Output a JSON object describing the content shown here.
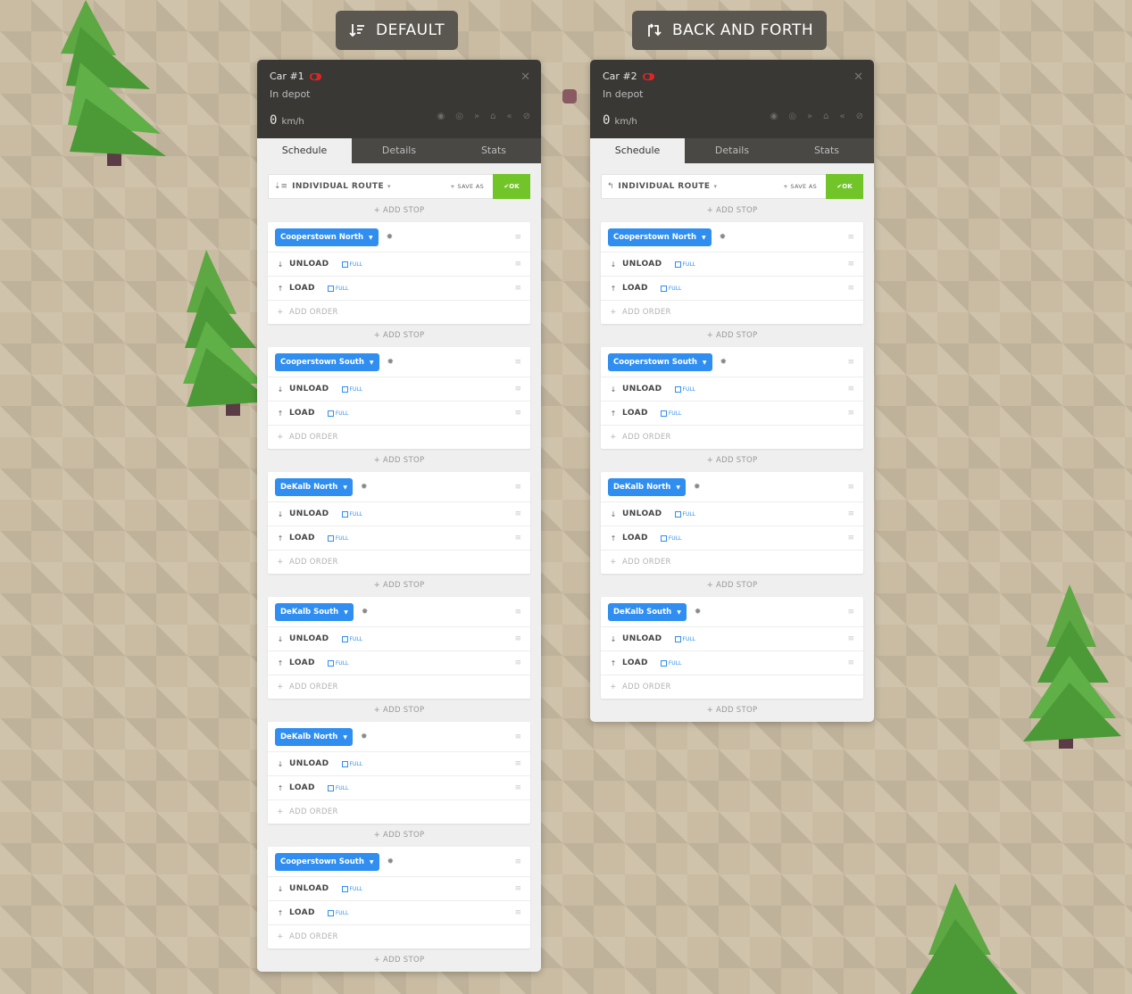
{
  "modes": [
    {
      "label": "DEFAULT",
      "icon": "sort-descending-icon"
    },
    {
      "label": "BACK AND FORTH",
      "icon": "return-arrow-icon"
    }
  ],
  "panels": [
    {
      "car_title": "Car #1",
      "status": "In depot",
      "speed": "0",
      "speed_unit": "km/h",
      "tabs": [
        "Schedule",
        "Details",
        "Stats"
      ],
      "route_type": "INDIVIDUAL ROUTE",
      "save_as": "SAVE AS",
      "ok": "OK",
      "add_stop": "ADD STOP",
      "add_order": "ADD ORDER",
      "stops": [
        {
          "station": "Cooperstown North",
          "orders": [
            {
              "name": "UNLOAD",
              "full": "FULL"
            },
            {
              "name": "LOAD",
              "full": "FULL"
            }
          ]
        },
        {
          "station": "Cooperstown South",
          "orders": [
            {
              "name": "UNLOAD",
              "full": "FULL"
            },
            {
              "name": "LOAD",
              "full": "FULL"
            }
          ]
        },
        {
          "station": "DeKalb North",
          "orders": [
            {
              "name": "UNLOAD",
              "full": "FULL"
            },
            {
              "name": "LOAD",
              "full": "FULL"
            }
          ]
        },
        {
          "station": "DeKalb South",
          "orders": [
            {
              "name": "UNLOAD",
              "full": "FULL"
            },
            {
              "name": "LOAD",
              "full": "FULL"
            }
          ]
        },
        {
          "station": "DeKalb North",
          "orders": [
            {
              "name": "UNLOAD",
              "full": "FULL"
            },
            {
              "name": "LOAD",
              "full": "FULL"
            }
          ]
        },
        {
          "station": "Cooperstown South",
          "orders": [
            {
              "name": "UNLOAD",
              "full": "FULL"
            },
            {
              "name": "LOAD",
              "full": "FULL"
            }
          ]
        }
      ]
    },
    {
      "car_title": "Car #2",
      "status": "In depot",
      "speed": "0",
      "speed_unit": "km/h",
      "tabs": [
        "Schedule",
        "Details",
        "Stats"
      ],
      "route_type": "INDIVIDUAL ROUTE",
      "save_as": "SAVE AS",
      "ok": "OK",
      "add_stop": "ADD STOP",
      "add_order": "ADD ORDER",
      "stops": [
        {
          "station": "Cooperstown North",
          "orders": [
            {
              "name": "UNLOAD",
              "full": "FULL"
            },
            {
              "name": "LOAD",
              "full": "FULL"
            }
          ]
        },
        {
          "station": "Cooperstown South",
          "orders": [
            {
              "name": "UNLOAD",
              "full": "FULL"
            },
            {
              "name": "LOAD",
              "full": "FULL"
            }
          ]
        },
        {
          "station": "DeKalb North",
          "orders": [
            {
              "name": "UNLOAD",
              "full": "FULL"
            },
            {
              "name": "LOAD",
              "full": "FULL"
            }
          ]
        },
        {
          "station": "DeKalb South",
          "orders": [
            {
              "name": "UNLOAD",
              "full": "FULL"
            },
            {
              "name": "LOAD",
              "full": "FULL"
            }
          ]
        }
      ]
    }
  ],
  "colors": {
    "station_button": "#2f8ef0",
    "ok_button": "#72c529",
    "header_bg": "#3a3835",
    "toggle_off": "#e02424"
  }
}
